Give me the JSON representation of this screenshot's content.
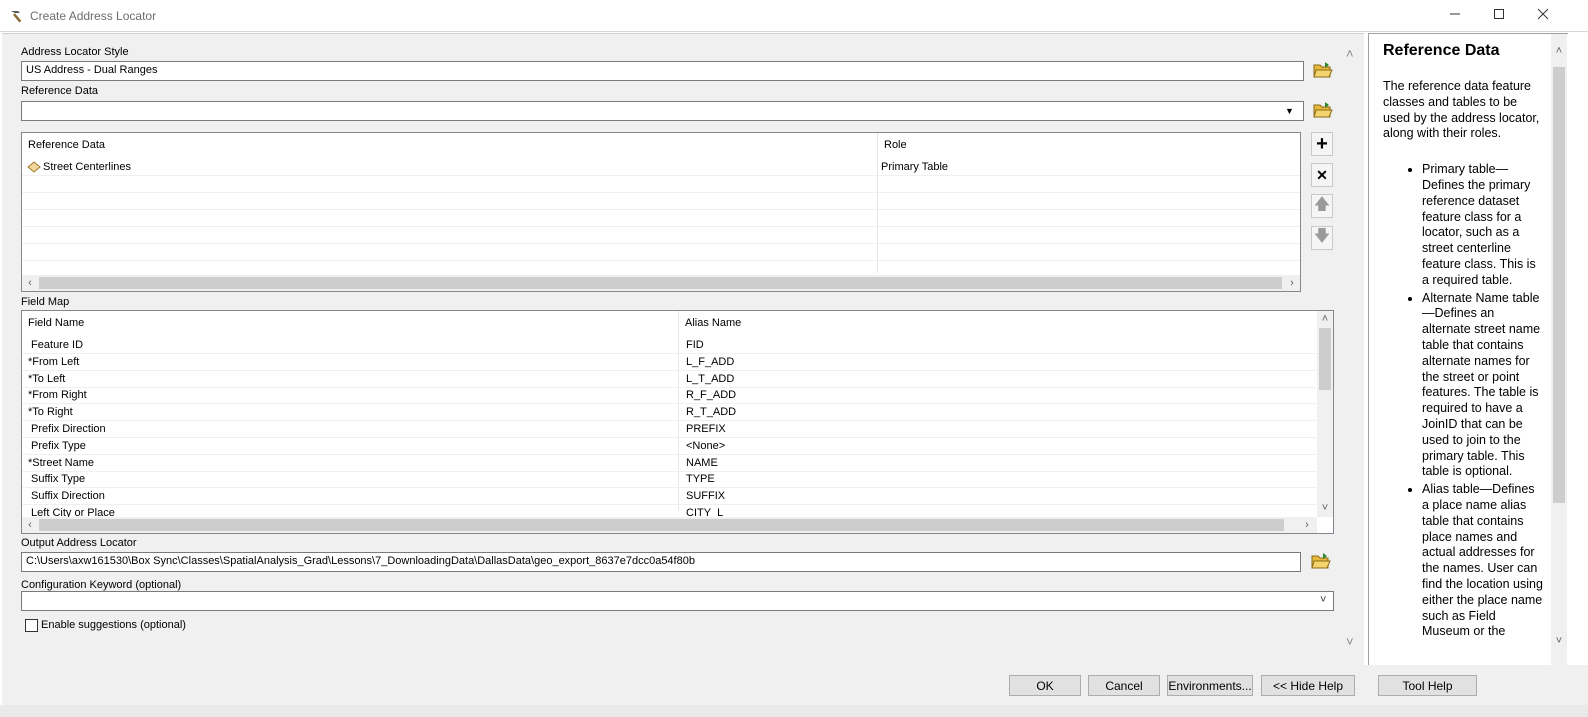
{
  "window": {
    "title": "Create Address Locator",
    "controls": [
      "minimize-icon",
      "maximize-icon",
      "close-icon"
    ]
  },
  "address_locator_style": {
    "label": "Address Locator Style",
    "value": "US Address - Dual Ranges"
  },
  "reference_data": {
    "label": "Reference Data",
    "dropdown_value": "",
    "columns": [
      "Reference Data",
      "Role"
    ],
    "rows": [
      {
        "data": "Street Centerlines",
        "role": "Primary Table"
      }
    ]
  },
  "field_map": {
    "label": "Field Map",
    "columns": [
      "Field Name",
      "Alias Name"
    ],
    "rows": [
      {
        "field": " Feature ID",
        "alias": "FID"
      },
      {
        "field": "*From Left",
        "alias": "L_F_ADD"
      },
      {
        "field": "*To Left",
        "alias": "L_T_ADD"
      },
      {
        "field": "*From Right",
        "alias": "R_F_ADD"
      },
      {
        "field": "*To Right",
        "alias": "R_T_ADD"
      },
      {
        "field": " Prefix Direction",
        "alias": "PREFIX"
      },
      {
        "field": " Prefix Type",
        "alias": "<None>"
      },
      {
        "field": "*Street Name",
        "alias": "NAME"
      },
      {
        "field": " Suffix Type",
        "alias": "TYPE"
      },
      {
        "field": " Suffix Direction",
        "alias": "SUFFIX"
      },
      {
        "field": " Left City or Place",
        "alias": "CITY_L"
      }
    ]
  },
  "output_locator": {
    "label": "Output Address Locator",
    "value": "C:\\Users\\axw161530\\Box Sync\\Classes\\SpatialAnalysis_Grad\\Lessons\\7_DownloadingData\\DallasData\\geo_export_8637e7dcc0a54f80b"
  },
  "config_keyword": {
    "label": "Configuration Keyword (optional)",
    "value": ""
  },
  "enable_suggestions": {
    "label": "Enable suggestions (optional)",
    "checked": false
  },
  "buttons": {
    "ok": "OK",
    "cancel": "Cancel",
    "environments": "Environments...",
    "hide_help": "<< Hide Help",
    "tool_help": "Tool Help"
  },
  "help": {
    "title": "Reference Data",
    "intro": "The reference data feature classes and tables to be used by the address locator, along with their roles.",
    "items": [
      "Primary table—Defines the primary reference dataset feature class for a locator, such as a street centerline feature class. This is a required table.",
      "Alternate Name table—Defines an alternate street name table that contains alternate names for the street or point features. The table is required to have a JoinID that can be used to join to the primary table. This table is optional.",
      "Alias table—Defines a place name alias table that contains place names and actual addresses for the names. User can find the location using either the place name such as Field Museum or the"
    ]
  },
  "colors": {
    "dialog_bg": "#f0f0f0",
    "folder_icon": "#e8b83c",
    "feature_icon": "#f2d79a"
  }
}
